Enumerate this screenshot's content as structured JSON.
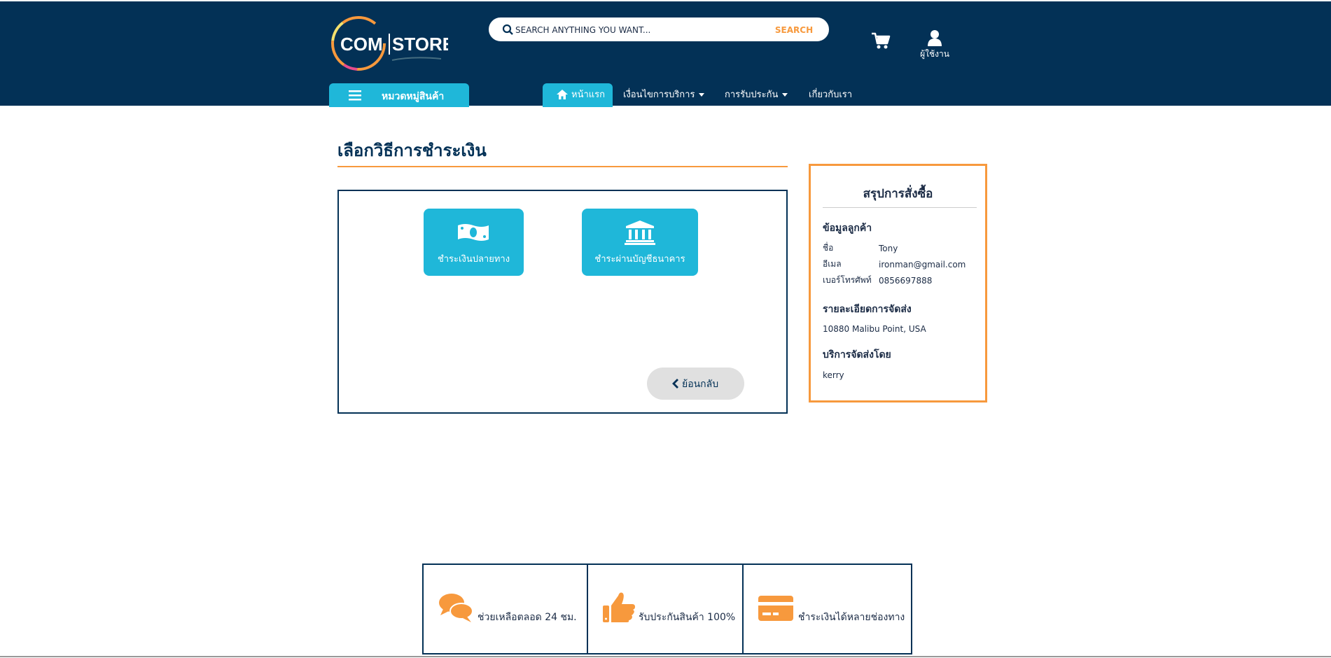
{
  "brand": {
    "logo_text_1": "COM",
    "logo_text_2": "STORE"
  },
  "search": {
    "placeholder": "SEARCH ANYTHING YOU WANT...",
    "button_label": "SEARCH"
  },
  "header": {
    "user_label": "ผู้ใช้งาน",
    "category_label": "หมวดหมู่สินค้า"
  },
  "nav": [
    {
      "label": "หน้าแรก",
      "icon": "home-icon"
    },
    {
      "label": "เงื่อนไขการบริการ",
      "has_dropdown": true
    },
    {
      "label": "การรับประกัน",
      "has_dropdown": true
    },
    {
      "label": "เกี่ยวกับเรา"
    }
  ],
  "main": {
    "title": "เลือกวิธีการชำระเงิน",
    "payment_options": [
      {
        "label": "ชำระเงินปลายทาง",
        "icon": "cash-icon"
      },
      {
        "label": "ชำระผ่านบัญชีธนาคาร",
        "icon": "bank-icon"
      }
    ],
    "back_label": "ย้อนกลับ"
  },
  "summary": {
    "title": "สรุปการสั่งซื้อ",
    "customer_title": "ข้อมูลลูกค้า",
    "customer_rows": [
      {
        "label": "ชื่อ",
        "value": "Tony"
      },
      {
        "label": "อีเมล",
        "value": "ironman@gmail.com"
      },
      {
        "label": "เบอร์โทรศัพท์",
        "value": "0856697888"
      }
    ],
    "shipping_title": "รายละเอียดการจัดส่ง",
    "shipping_address": "10880 Malibu Point, USA",
    "carrier_title": "บริการจัดส่งโดย",
    "carrier": "kerry"
  },
  "features": [
    {
      "label": "ช่วยเหลือตลอด 24 ชม.",
      "icon": "chat-icon"
    },
    {
      "label": "รับประกันสินค้า 100%",
      "icon": "thumbs-up-icon"
    },
    {
      "label": "ชำระเงินได้หลายช่องทาง",
      "icon": "credit-card-icon"
    }
  ],
  "colors": {
    "header_bg": "#033156",
    "accent_blue": "#1fb7d9",
    "accent_orange": "#f7993d"
  }
}
